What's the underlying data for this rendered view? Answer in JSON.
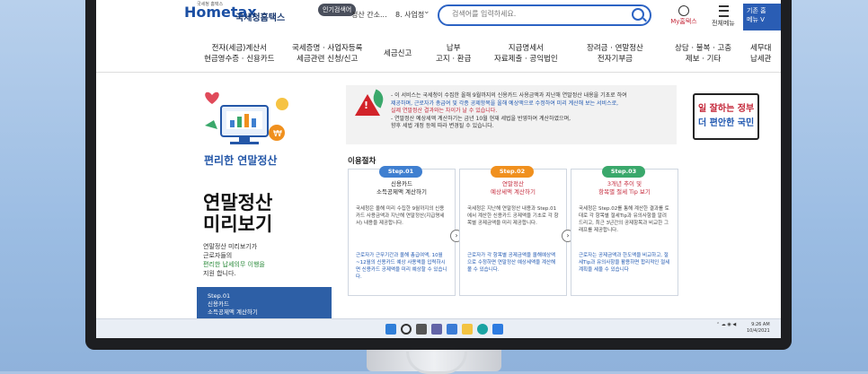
{
  "header": {
    "logo_small": "국세청 홈택스",
    "logo": "Hometax",
    "org": "국세청홈택스",
    "popular_badge": "인기검색어",
    "popular_1": "정산 간소...",
    "popular_2": "8. 사업정",
    "search_placeholder": "검색어를 입력하세요.",
    "mytax": "My홈택스",
    "all_menu": "전체메뉴",
    "corner_btn_1": "기존 홈",
    "corner_btn_2": "메뉴 V"
  },
  "nav": [
    {
      "l1": "전자(세금)계산서",
      "l2": "현금영수증 · 신용카드"
    },
    {
      "l1": "국세증명 · 사업자등록",
      "l2": "세금관련 신청/신고"
    },
    {
      "l1": "세금신고",
      "l2": ""
    },
    {
      "l1": "납부",
      "l2": "고지 · 환급"
    },
    {
      "l1": "지급명세서",
      "l2": "자료제출 · 공익법인"
    },
    {
      "l1": "장려금 · 연말정산",
      "l2": "전자기부금"
    },
    {
      "l1": "상담 · 불복 · 고충",
      "l2": "제보 · 기타"
    },
    {
      "l1": "세무대",
      "l2": "납세관"
    }
  ],
  "left": {
    "illus_title": "편리한 연말정산",
    "big_title_1": "연말정산",
    "big_title_2": "미리보기",
    "desc_1": "연말정산 미리보기가",
    "desc_2": "근로자들의",
    "desc_3": "편리한 납세의무 이행을",
    "desc_4": "지원 합니다.",
    "panel_1": "Step.01",
    "panel_2": "신용카드",
    "panel_3": "소득공제액 계산하기"
  },
  "notice": {
    "l1": "- 이 서비스는 국세청이 수집한 올해 9월까지의 신용카드 사용금액과 지난해 연말정산 내용을 기초로 하여",
    "l2": "제공하며, 근로자가 총급여 및 각종 공제항목을 올해 예상액으로 수정하여 미리 계산해 보는 서비스로,",
    "l3": "실제 연말정산 결과와는 차이가 날 수 있습니다.",
    "l4": "- 연말정산 예상세액 계산하기는 금년 10월 현재 세법을 반영하여 계산하였으며,",
    "l5": "향후 세법 개정 등에 따라 변경될 수 있습니다."
  },
  "process_title": "이용절차",
  "steps": [
    {
      "badge": "Step.01",
      "head_1": "신용카드",
      "head_2": "소득공제액 계산하기",
      "body": "국세청은 올해 미리 수집한 9월까지의 신용카드 사용금액과 지난해 연말정산(지급명세서) 내용을 제공합니다.",
      "foot": "근로자가 근무기간과 올해 총급여액, 10월~12월의 신용카드 예상 사용액을 입력하시면 신용카드 공제액을 미리 예상할 수 있습니다."
    },
    {
      "badge": "Step.02",
      "head_1": "연말정산",
      "head_2": "예상세액 계산하기",
      "body": "국세청은 지난해 연말정산 내용과 Step.01에서 계산한 신용카드 공제액을 기초로 각 항목별 공제금액을 미리 제공합니다.",
      "foot": "근로자가 각 항목별 공제금액을 올해예상액으로 수정하면 연말정산 예상세액을 계산해 볼 수 있습니다."
    },
    {
      "badge": "Step.03",
      "head_1": "3개년 추이 및",
      "head_2": "항목별 절세 Tip 보기",
      "body": "국세청은 Step.02를 통해 계산한 결과를 토대로 각 항목별 절세Tip과 유의사항을 알려드리고, 최근 3년간의 공제항목과 비교한 그래프를 제공합니다.",
      "foot": "근로자는 공제금액과 한도액을 비교하고, 절세Tip과 유의사항을 활용하면 합리적인 절세계획을 세울 수 있습니다"
    }
  ],
  "banner": {
    "l1": "일 잘하는 정부",
    "l2": "더 편안한 국민"
  },
  "tray": {
    "time": "9:26 AM",
    "date": "10/4/2021"
  },
  "colors": {
    "accent": "#2c63c4",
    "step1": "#3f7fd0",
    "step2": "#f0901e",
    "step3": "#3aa86b",
    "danger": "#d2232a"
  }
}
